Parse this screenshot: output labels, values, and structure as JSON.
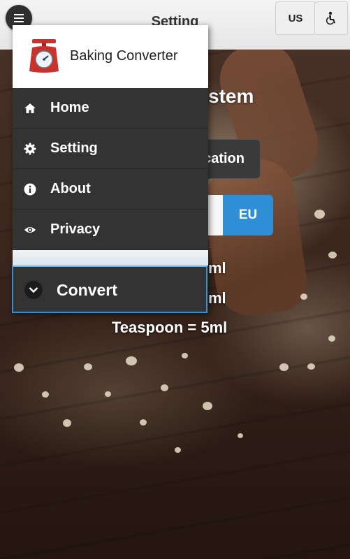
{
  "header": {
    "title": "Setting",
    "unit_button_label": "US",
    "accessibility_icon": "accessibility-icon",
    "menu_icon": "hamburger-menu-icon"
  },
  "main": {
    "title_partial": "stem",
    "location_button_label": "cation",
    "region_options": {
      "selected": "EU"
    },
    "measurements": [
      "ml",
      "ml",
      "Teaspoon = 5ml"
    ]
  },
  "drawer": {
    "app_name": "Baking Converter",
    "logo_icon": "kitchen-scale-icon",
    "items": [
      {
        "label": "Home",
        "icon": "home-icon"
      },
      {
        "label": "Setting",
        "icon": "gear-icon"
      },
      {
        "label": "About",
        "icon": "info-icon"
      },
      {
        "label": "Privacy",
        "icon": "eye-icon"
      }
    ],
    "convert": {
      "label": "Convert",
      "icon": "chevron-down-icon"
    }
  },
  "colors": {
    "accent_blue": "#2f8fd6",
    "drawer_bg": "#333333",
    "scale_red": "#c9322c"
  }
}
